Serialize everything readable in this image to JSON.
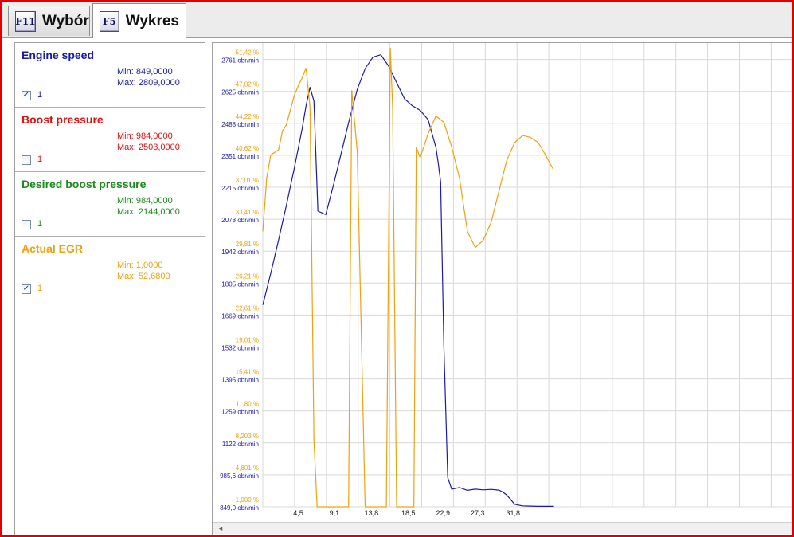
{
  "tabs": [
    {
      "key": "F11",
      "label": "Wybór",
      "active": false
    },
    {
      "key": "F5",
      "label": "Wykres",
      "active": true
    }
  ],
  "series": [
    {
      "name": "Engine speed",
      "min": "Min: 849,0000",
      "max": "Max: 2809,0000",
      "checked": true,
      "index": "1",
      "color": "#1a1aaa"
    },
    {
      "name": "Boost pressure",
      "min": "Min: 984,0000",
      "max": "Max: 2503,0000",
      "checked": false,
      "index": "1",
      "color": "#e01010"
    },
    {
      "name": "Desired boost pressure",
      "min": "Min: 984,0000",
      "max": "Max: 2144,0000",
      "checked": false,
      "index": "1",
      "color": "#1a8a1a"
    },
    {
      "name": "Actual EGR",
      "min": "Min: 1,0000",
      "max": "Max: 52,6800",
      "checked": true,
      "index": "1",
      "color": "#f0a010"
    }
  ],
  "chart_data": {
    "type": "line",
    "grid": true,
    "x_ticks": [
      "4,5",
      "9,1",
      "13,8",
      "18,5",
      "22,9",
      "27,3",
      "31,8"
    ],
    "x_tick_values": [
      4.5,
      9.1,
      13.8,
      18.5,
      22.9,
      27.3,
      31.8
    ],
    "xlim": [
      0,
      67.4
    ],
    "ylim_rpm": [
      849,
      2829.9
    ],
    "ylim_pct": [
      1.0,
      52.68
    ],
    "y_ticks_rpm": [
      "849,0 obr/min",
      "985,6 obr/min",
      "1122 obr/min",
      "1259 obr/min",
      "1395 obr/min",
      "1532 obr/min",
      "1669 obr/min",
      "1805 obr/min",
      "1942 obr/min",
      "2078 obr/min",
      "2215 obr/min",
      "2351 obr/min",
      "2488 obr/min",
      "2625 obr/min",
      "2761 obr/min"
    ],
    "y_ticks_pct": [
      "1,000 %",
      "4,601 %",
      "8,203 %",
      "11,80 %",
      "15,41 %",
      "19,01 %",
      "22,61 %",
      "26,21 %",
      "29,81 %",
      "33,41 %",
      "37,01 %",
      "40,62 %",
      "44,22 %",
      "47,82 %",
      "51,42 %"
    ],
    "series": [
      {
        "name": "Engine speed",
        "axis": "rpm",
        "color": "#1a1aaa",
        "x": [
          0,
          1,
          2,
          3,
          4,
          5,
          5.5,
          6,
          6.5,
          7,
          8,
          9,
          10,
          11,
          12,
          13,
          14,
          15,
          16,
          17,
          18,
          19,
          20,
          21,
          22,
          22.3,
          22.6,
          23,
          23.5,
          24,
          25,
          26,
          27,
          28,
          29,
          30,
          30.5,
          31,
          32,
          33,
          34,
          35,
          36,
          37
        ],
        "y": [
          1720,
          1855,
          2000,
          2150,
          2310,
          2480,
          2580,
          2660,
          2600,
          2125,
          2110,
          2240,
          2380,
          2520,
          2650,
          2740,
          2790,
          2800,
          2750,
          2680,
          2610,
          2580,
          2560,
          2520,
          2400,
          2330,
          2250,
          1550,
          975,
          925,
          932,
          920,
          925,
          922,
          924,
          921,
          912,
          900,
          860,
          853,
          852,
          851,
          851,
          851
        ]
      },
      {
        "name": "Actual EGR",
        "axis": "pct",
        "color": "#f0a010",
        "x": [
          0,
          0.5,
          1,
          2,
          2.5,
          3,
          4,
          4.5,
          5,
          5.5,
          6,
          6.5,
          6.9,
          9,
          10.9,
          11.3,
          12,
          13,
          13.3,
          14.3,
          15.7,
          16.2,
          16.5,
          17,
          18,
          19,
          19.2,
          19.5,
          20,
          21,
          22,
          23,
          24,
          25,
          26,
          27,
          28,
          29,
          30,
          31,
          32,
          33,
          34,
          35,
          36,
          36.9
        ],
        "y": [
          32.0,
          38.0,
          40.6,
          41.2,
          43.3,
          44.0,
          47.3,
          48.4,
          49.3,
          50.4,
          46.0,
          8.5,
          1.0,
          1.0,
          1.0,
          47.9,
          41.0,
          1.0,
          1.0,
          1.0,
          1.0,
          52.68,
          46.0,
          1.0,
          1.0,
          1.0,
          1.0,
          41.5,
          40.3,
          43.0,
          45.0,
          44.3,
          41.5,
          38.0,
          32.0,
          30.2,
          31.0,
          33.0,
          36.5,
          40.0,
          42.0,
          42.8,
          42.6,
          42.0,
          40.5,
          39.0
        ]
      }
    ]
  }
}
